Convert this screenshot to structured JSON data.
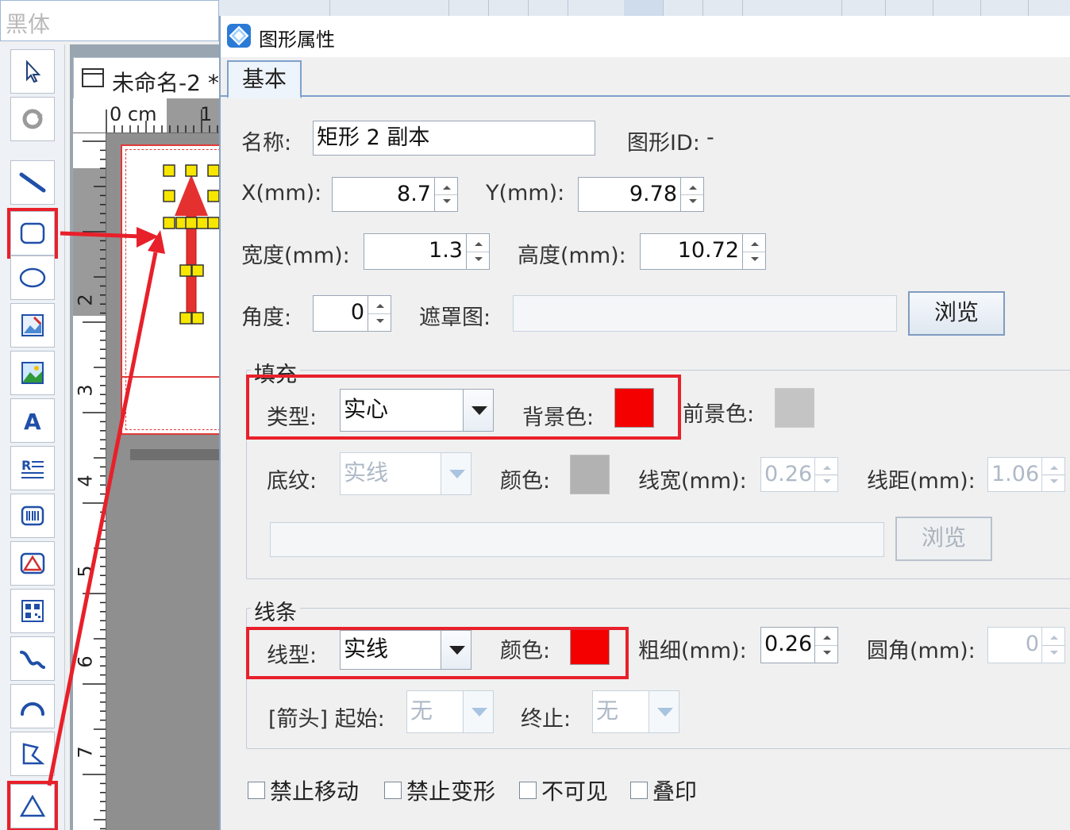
{
  "app": {
    "font_name": "黑体",
    "document_tab": "未命名-2 *",
    "ruler_labels": [
      "0 cm",
      "1",
      "2",
      "3",
      "4",
      "5",
      "6",
      "7"
    ]
  },
  "dialog": {
    "title": "图形属性",
    "tab_basic": "基本",
    "name_label": "名称:",
    "name_value": "矩形 2 副本",
    "shape_id_label": "图形ID:",
    "shape_id_value": "-",
    "x_label": "X(mm):",
    "x_value": "8.7",
    "y_label": "Y(mm):",
    "y_value": "9.78",
    "width_label": "宽度(mm):",
    "width_value": "1.3",
    "height_label": "高度(mm):",
    "height_value": "10.72",
    "angle_label": "角度:",
    "angle_value": "0",
    "mask_label": "遮罩图:",
    "browse_label": "浏览",
    "fill": {
      "title": "填充",
      "type_label": "类型:",
      "type_value": "实心",
      "bg_color_label": "背景色:",
      "bg_color": "#f50000",
      "fg_color_label": "前景色:",
      "fg_color": "#c4c4c4",
      "pattern_label": "底纹:",
      "pattern_value": "实线",
      "pattern_color_label": "颜色:",
      "pattern_color": "#b2b2b2",
      "line_width_label": "线宽(mm):",
      "line_width_value": "0.26",
      "line_spacing_label": "线距(mm):",
      "line_spacing_value": "1.06",
      "browse_label": "浏览"
    },
    "line": {
      "title": "线条",
      "style_label": "线型:",
      "style_value": "实线",
      "color_label": "颜色:",
      "color": "#f50000",
      "thickness_label": "粗细(mm):",
      "thickness_value": "0.26",
      "radius_label": "圆角(mm):",
      "radius_value": "0",
      "arrow_start_label": "[箭头] 起始:",
      "arrow_start_value": "无",
      "arrow_end_label": "终止:",
      "arrow_end_value": "无"
    },
    "checkboxes": [
      "禁止移动",
      "禁止变形",
      "不可见",
      "叠印"
    ]
  },
  "colors": {
    "highlight": "#e8202a",
    "accent": "#7fa0cc"
  },
  "icons": {
    "dialog": "diamond-app-icon",
    "tools": [
      "pointer-icon",
      "rotate-icon",
      "line-icon",
      "rounded-rect-icon",
      "ellipse-icon",
      "image-edit-icon",
      "picture-icon",
      "text-icon",
      "rich-text-icon",
      "barcode-icon",
      "shape-icon",
      "qrcode-icon",
      "curve-icon",
      "arc-icon",
      "polygon-icon",
      "triangle-icon"
    ]
  }
}
